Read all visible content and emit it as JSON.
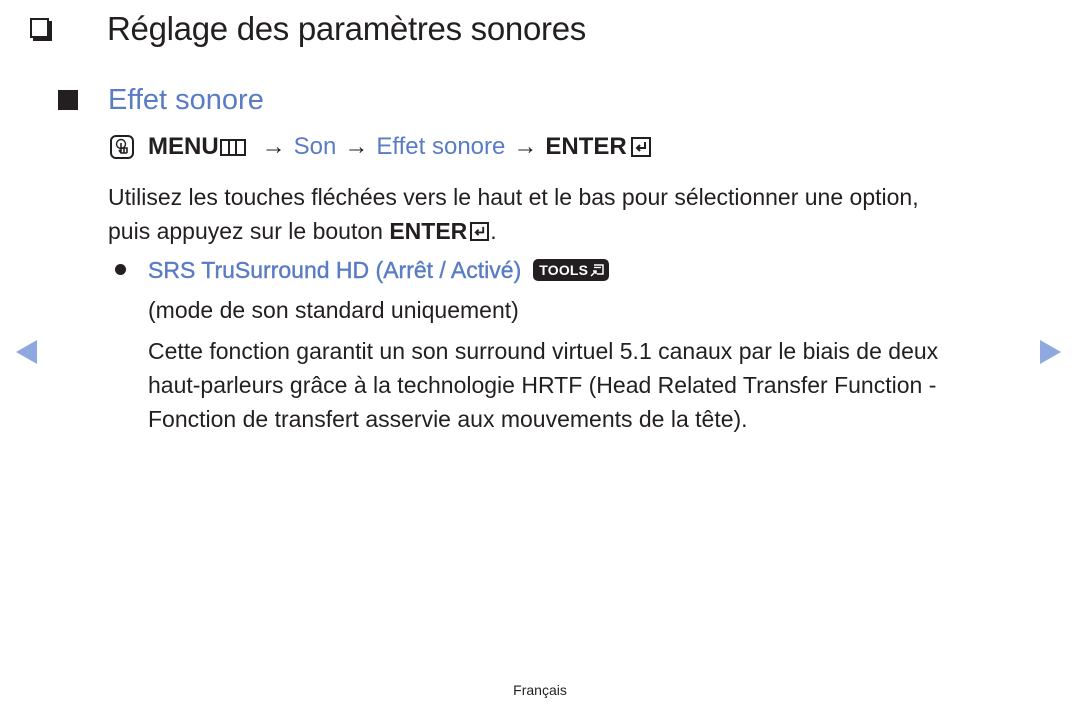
{
  "heading": {
    "title": "Réglage des paramètres sonores",
    "icon": "checkbox-square-icon"
  },
  "section": {
    "title": "Effet sonore",
    "icon": "filled-square-icon"
  },
  "menu_path": {
    "icon": "hand-touch-icon",
    "items": [
      {
        "label": "MENU",
        "icon": "menu-icon",
        "style": "bold"
      },
      {
        "label": "Son",
        "style": "blue"
      },
      {
        "label": "Effet sonore",
        "style": "blue"
      },
      {
        "label": "ENTER",
        "icon": "enter-icon",
        "style": "bold"
      }
    ],
    "separator": "→"
  },
  "instructions": {
    "line1": "Utilisez les touches fléchées vers le haut et le bas pour sélectionner une option,",
    "line2_prefix": "puis appuyez sur le bouton ",
    "line2_button": "ENTER",
    "line2_suffix": "."
  },
  "option": {
    "title": "SRS TruSurround HD (Arrêt / Activé)",
    "badge": "TOOLS",
    "note": "(mode de son standard uniquement)",
    "description": [
      "Cette fonction garantit un son surround virtuel 5.1 canaux par le biais de deux",
      "haut-parleurs grâce à la technologie HRTF (Head Related Transfer Function -",
      "Fonction de transfert asservie aux mouvements de la tête)."
    ]
  },
  "navigation": {
    "prev_icon": "triangle-left-icon",
    "next_icon": "triangle-right-icon",
    "color": "#8fa8e0"
  },
  "colors": {
    "accent": "#5a7cc4",
    "text": "#231f20"
  },
  "footer": {
    "language": "Français"
  }
}
